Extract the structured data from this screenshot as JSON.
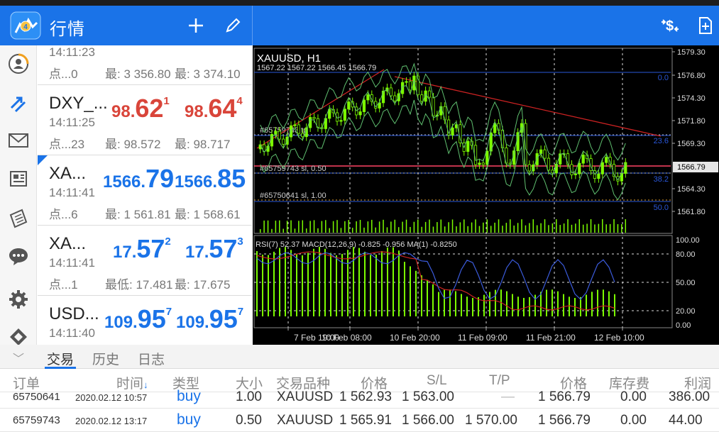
{
  "header": {
    "title": "行情",
    "add_icon": "plus-icon",
    "edit_icon": "pencil-icon",
    "trade_icon": "dollar-arrows-icon",
    "new_order_icon": "new-document-icon"
  },
  "sidebar": {
    "items": [
      {
        "icon": "account-icon"
      },
      {
        "icon": "trade-arrows-icon"
      },
      {
        "icon": "mail-icon"
      },
      {
        "icon": "news-icon"
      },
      {
        "icon": "journal-icon"
      },
      {
        "icon": "chat-icon"
      },
      {
        "icon": "settings-icon"
      },
      {
        "icon": "community-icon"
      }
    ]
  },
  "quotes": [
    {
      "symbol": "",
      "time": "14:11:23",
      "spread": "点...0",
      "low": "最: 3 356.80",
      "high": "最: 3 374.10",
      "bid": {
        "pre": "",
        "big": "",
        "sup": ""
      },
      "ask": {
        "pre": "",
        "big": "",
        "sup": ""
      }
    },
    {
      "symbol": "DXY_...",
      "time": "14:11:25",
      "spread": "点...23",
      "low": "最: 98.572",
      "high": "最: 98.717",
      "bid": {
        "pre": "98.",
        "big": "62",
        "sup": "1"
      },
      "ask": {
        "pre": "98.",
        "big": "64",
        "sup": "4"
      }
    },
    {
      "symbol": "XA...",
      "time": "14:11:41",
      "spread": "点...6",
      "low": "最: 1 561.81",
      "high": "最: 1 568.61",
      "bid": {
        "pre": "1566.",
        "big": "79",
        "sup": ""
      },
      "ask": {
        "pre": "1566.",
        "big": "85",
        "sup": ""
      }
    },
    {
      "symbol": "XA...",
      "time": "14:11:41",
      "spread": "点...1",
      "low": "最低: 17.481",
      "high": "最: 17.675",
      "bid": {
        "pre": "17.",
        "big": "57",
        "sup": "2"
      },
      "ask": {
        "pre": "17.",
        "big": "57",
        "sup": "3"
      }
    },
    {
      "symbol": "USD...",
      "time": "14:11:40",
      "spread": "",
      "low": "",
      "high": "",
      "bid": {
        "pre": "109.",
        "big": "95",
        "sup": "7"
      },
      "ask": {
        "pre": "109.",
        "big": "95",
        "sup": "7"
      }
    }
  ],
  "chart": {
    "symbol": "XAUUSD, H1",
    "ohlc": "1567.22 1567.22 1566.45 1566.79",
    "price_labels": [
      "1579.30",
      "1576.80",
      "1574.30",
      "1571.80",
      "1569.30",
      "1566.79",
      "1564.30",
      "1561.80"
    ],
    "fib_labels": [
      "0.0",
      "23.6",
      "38.2",
      "50.0"
    ],
    "order_labels": [
      "#65759743 tp",
      "#65759743 sl, 0.50",
      "#65750641 sl, 1.00"
    ],
    "indicator_label": "RSI(7) 52.37 MACD(12,26,9) -0.825 -0.956 MA(1) -0.8250",
    "indicator_levels": [
      "100.00",
      "80.00",
      "50.00",
      "20.00",
      "0.00"
    ],
    "time_labels": [
      "7 Feb 19:00",
      "10 Feb 08:00",
      "10 Feb 20:00",
      "11 Feb 09:00",
      "11 Feb 21:00",
      "12 Feb 10:00"
    ],
    "colors": {
      "bull": "#7CFC00",
      "bear": "#000000",
      "fib": "#2a57d8",
      "trend": "#cc2222",
      "current": "#ff4466",
      "bands": "#5fbf6f",
      "rsi": "#3b5bdb",
      "signal": "#cc2222"
    }
  },
  "bottom": {
    "collapse_icon": "chevron-down-icon",
    "tabs": [
      "交易",
      "历史",
      "日志"
    ],
    "columns": [
      "订单",
      "时间",
      "类型",
      "大小",
      "交易品种",
      "价格",
      "S/L",
      "T/P",
      "价格",
      "库存费",
      "利润"
    ],
    "sort_arrow": "↓",
    "rows": [
      {
        "order": "65750641",
        "time": "2020.02.12 10:57",
        "type": "buy",
        "size": "1.00",
        "symbol": "XAUUSD",
        "open": "1 562.93",
        "sl": "1 563.00",
        "tp": "—",
        "price": "1 566.79",
        "swap": "0.00",
        "profit": "386.00"
      },
      {
        "order": "65759743",
        "time": "2020.02.12 13:17",
        "type": "buy",
        "size": "0.50",
        "symbol": "XAUUSD",
        "open": "1 565.91",
        "sl": "1 566.00",
        "tp": "1 570.00",
        "price": "1 566.79",
        "swap": "0.00",
        "profit": "44.00"
      }
    ]
  }
}
